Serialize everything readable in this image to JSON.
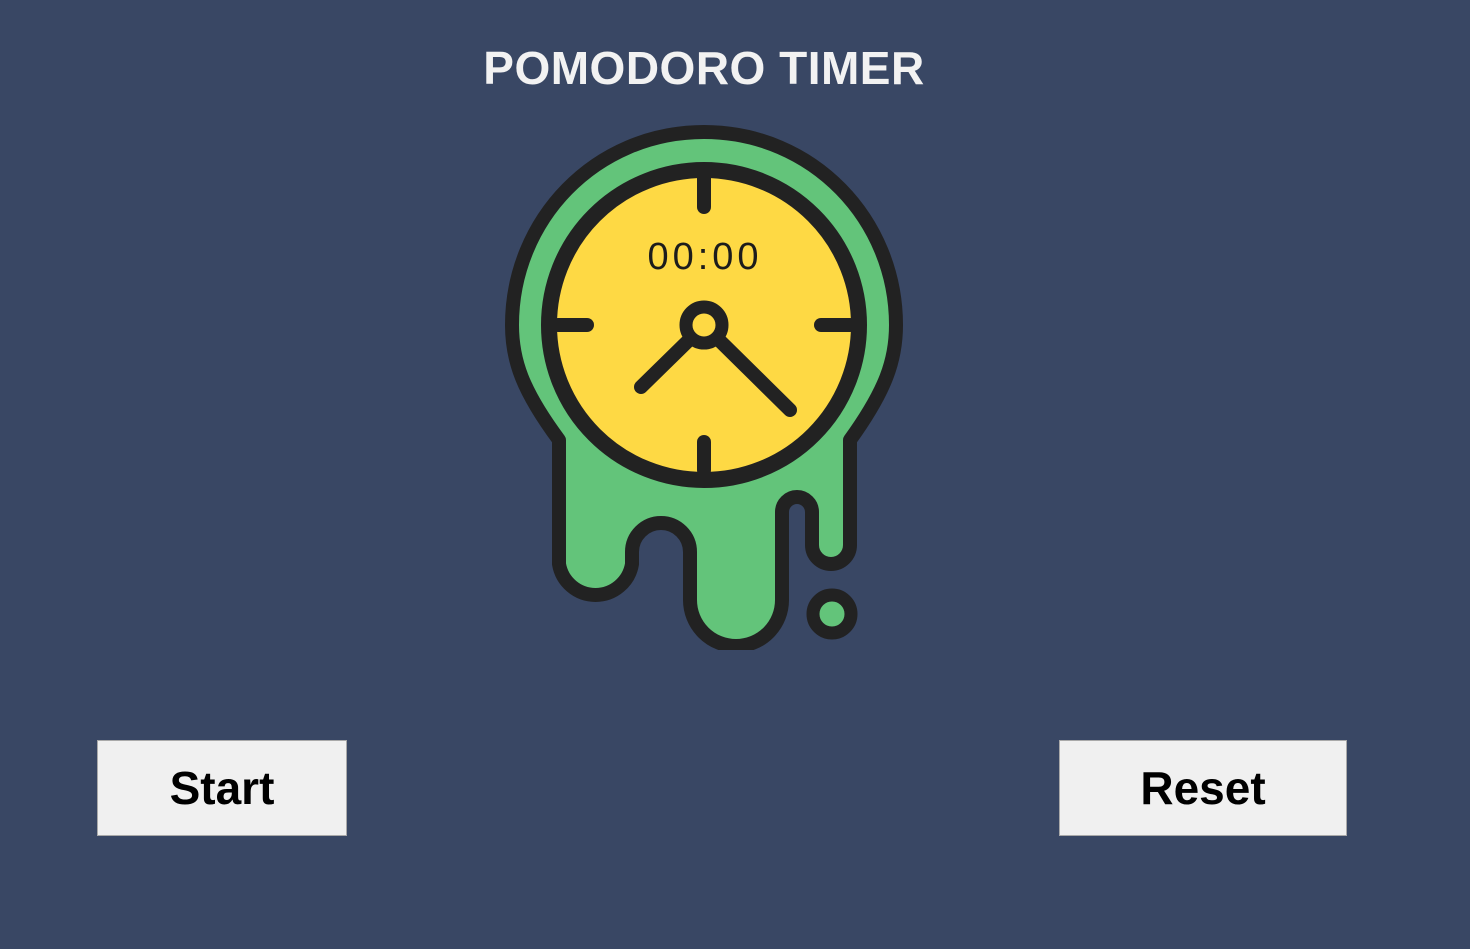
{
  "window": {
    "title": "POMODORO TIMER"
  },
  "timer": {
    "display": "00:00"
  },
  "controls": {
    "start_label": "Start",
    "reset_label": "Reset"
  },
  "icons": {
    "clock": "melting-clock-icon"
  },
  "colors": {
    "background": "#394764",
    "clock_face": "#FED944",
    "clock_drip": "#63C47A",
    "outline": "#222222",
    "button_bg": "#F0F0F0",
    "title_text": "#F2F2F2"
  }
}
